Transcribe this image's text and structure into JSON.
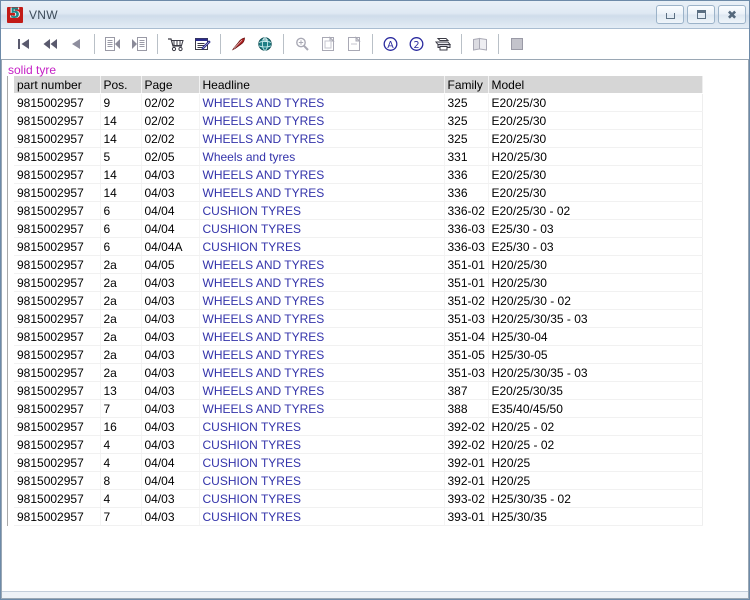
{
  "window": {
    "title": "VNW",
    "app_icon": "app-5-icon",
    "icon_glyph": "5",
    "controls": {
      "minimize": "minimize-button",
      "maximize": "maximize-button",
      "close": "close-button"
    }
  },
  "toolbar": {
    "buttons": [
      {
        "name": "first-record-icon",
        "enabled": true,
        "tip": "First"
      },
      {
        "name": "fast-rewind-icon",
        "enabled": true,
        "tip": "Back several"
      },
      {
        "name": "previous-record-icon",
        "enabled": true,
        "tip": "Previous"
      },
      {
        "name": "document-first-icon",
        "enabled": false,
        "tip": "First document"
      },
      {
        "name": "document-next-icon",
        "enabled": false,
        "tip": "Next document"
      },
      {
        "name": "shopping-cart-icon",
        "enabled": true,
        "tip": "Basket"
      },
      {
        "name": "order-form-icon",
        "enabled": true,
        "tip": "Order list"
      },
      {
        "name": "red-pen-icon",
        "enabled": true,
        "tip": "Annotate"
      },
      {
        "name": "globe-icon",
        "enabled": true,
        "tip": "Web"
      },
      {
        "name": "zoom-icon",
        "enabled": false,
        "tip": "Zoom"
      },
      {
        "name": "page-copy-icon",
        "enabled": false,
        "tip": "Copy page"
      },
      {
        "name": "page-new-icon",
        "enabled": false,
        "tip": "New page"
      },
      {
        "name": "letter-a-icon",
        "enabled": true,
        "tip": "A"
      },
      {
        "name": "number-2-icon",
        "enabled": true,
        "tip": "2"
      },
      {
        "name": "printer-icon",
        "enabled": true,
        "tip": "Print"
      },
      {
        "name": "book-icon",
        "enabled": false,
        "tip": "Manual"
      },
      {
        "name": "stop-icon",
        "enabled": false,
        "tip": "Stop"
      }
    ]
  },
  "search": {
    "query_label": "solid tyre",
    "query_color": "#c520c5"
  },
  "table": {
    "columns": [
      {
        "key": "part_number",
        "label": "part number"
      },
      {
        "key": "pos",
        "label": "Pos."
      },
      {
        "key": "page",
        "label": "Page"
      },
      {
        "key": "headline",
        "label": "Headline"
      },
      {
        "key": "family",
        "label": "Family"
      },
      {
        "key": "model",
        "label": "Model"
      }
    ],
    "link_color": "#3333aa",
    "rows": [
      [
        "9815002957",
        "9",
        "02/02",
        "WHEELS AND TYRES",
        "325",
        "E20/25/30"
      ],
      [
        "9815002957",
        "14",
        "02/02",
        "WHEELS AND TYRES",
        "325",
        "E20/25/30"
      ],
      [
        "9815002957",
        "14",
        "02/02",
        "WHEELS AND TYRES",
        "325",
        "E20/25/30"
      ],
      [
        "9815002957",
        "5",
        "02/05",
        "Wheels and tyres",
        "331",
        "H20/25/30"
      ],
      [
        "9815002957",
        "14",
        "04/03",
        "WHEELS AND TYRES",
        "336",
        "E20/25/30"
      ],
      [
        "9815002957",
        "14",
        "04/03",
        "WHEELS AND TYRES",
        "336",
        "E20/25/30"
      ],
      [
        "9815002957",
        "6",
        "04/04",
        "CUSHION TYRES",
        "336-02",
        "E20/25/30 - 02"
      ],
      [
        "9815002957",
        "6",
        "04/04",
        "CUSHION TYRES",
        "336-03",
        "E25/30 - 03"
      ],
      [
        "9815002957",
        "6",
        "04/04A",
        "CUSHION TYRES",
        "336-03",
        "E25/30 - 03"
      ],
      [
        "9815002957",
        "2a",
        "04/05",
        "WHEELS AND TYRES",
        "351-01",
        "H20/25/30"
      ],
      [
        "9815002957",
        "2a",
        "04/03",
        "WHEELS AND TYRES",
        "351-01",
        "H20/25/30"
      ],
      [
        "9815002957",
        "2a",
        "04/03",
        "WHEELS AND TYRES",
        "351-02",
        "H20/25/30 - 02"
      ],
      [
        "9815002957",
        "2a",
        "04/03",
        "WHEELS AND TYRES",
        "351-03",
        "H20/25/30/35 - 03"
      ],
      [
        "9815002957",
        "2a",
        "04/03",
        "WHEELS AND TYRES",
        "351-04",
        "H25/30-04"
      ],
      [
        "9815002957",
        "2a",
        "04/03",
        "WHEELS AND TYRES",
        "351-05",
        "H25/30-05"
      ],
      [
        "9815002957",
        "2a",
        "04/03",
        "WHEELS AND TYRES",
        "351-03",
        "H20/25/30/35 - 03"
      ],
      [
        "9815002957",
        "13",
        "04/03",
        "WHEELS AND TYRES",
        "387",
        "E20/25/30/35"
      ],
      [
        "9815002957",
        "7",
        "04/03",
        "WHEELS AND TYRES",
        "388",
        "E35/40/45/50"
      ],
      [
        "9815002957",
        "16",
        "04/03",
        "CUSHION TYRES",
        "392-02",
        "H20/25 - 02"
      ],
      [
        "9815002957",
        "4",
        "04/03",
        "CUSHION TYRES",
        "392-02",
        "H20/25 - 02"
      ],
      [
        "9815002957",
        "4",
        "04/04",
        "CUSHION TYRES",
        "392-01",
        "H20/25"
      ],
      [
        "9815002957",
        "8",
        "04/04",
        "CUSHION TYRES",
        "392-01",
        "H20/25"
      ],
      [
        "9815002957",
        "4",
        "04/03",
        "CUSHION TYRES",
        "393-02",
        "H25/30/35 - 02"
      ],
      [
        "9815002957",
        "7",
        "04/03",
        "CUSHION TYRES",
        "393-01",
        "H25/30/35"
      ]
    ]
  }
}
